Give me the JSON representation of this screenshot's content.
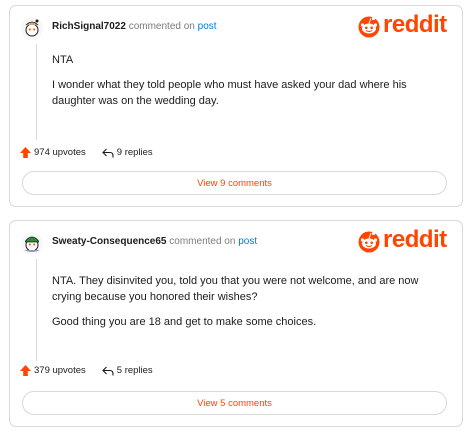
{
  "brand": {
    "wordmark": "reddit",
    "color": "#ff4500",
    "icon": "reddit-snoo-icon"
  },
  "comments": [
    {
      "username": "RichSignal7022",
      "commented_on": "commented on",
      "post_link": "post",
      "body": [
        "NTA",
        "I wonder what they told people who must have asked your dad where his daughter was on the wedding day."
      ],
      "upvotes": "974 upvotes",
      "replies": "9 replies",
      "view_comments": "View 9 comments"
    },
    {
      "username": "Sweaty-Consequence65",
      "commented_on": "commented on",
      "post_link": "post",
      "body": [
        "NTA. They disinvited you, told you that you were not welcome, and are now crying because you honored their wishes?",
        "Good thing you are 18 and get to make some choices."
      ],
      "upvotes": "379 upvotes",
      "replies": "5 replies",
      "view_comments": "View 5 comments"
    }
  ]
}
